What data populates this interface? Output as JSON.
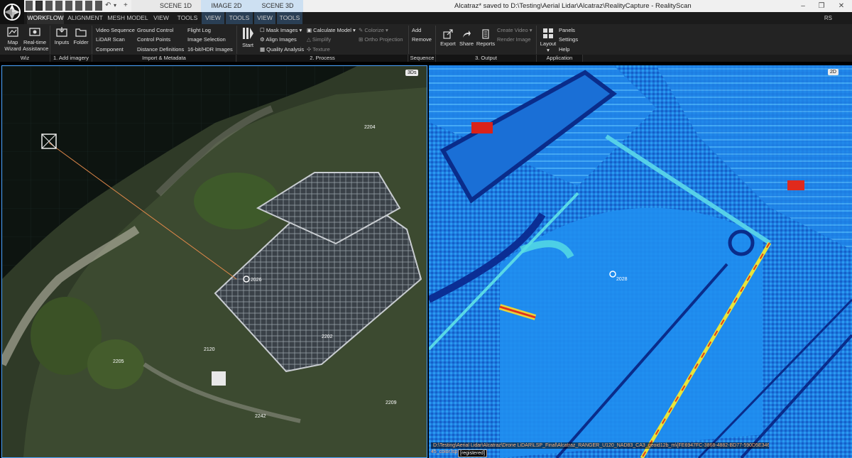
{
  "scene_tabs": [
    {
      "label": "SCENE 1D"
    },
    {
      "label": "IMAGE 2D"
    },
    {
      "label": "SCENE 3D"
    }
  ],
  "window": {
    "title": "Alcatraz* saved to D:\\Testing\\Aerial Lidar\\Alcatraz\\RealityCapture - RealityScan",
    "rs_label": "RS"
  },
  "ribbon_tabs": [
    {
      "label": "WORKFLOW"
    },
    {
      "label": "ALIGNMENT"
    },
    {
      "label": "MESH MODEL"
    },
    {
      "label": "VIEW"
    },
    {
      "label": "TOOLS"
    },
    {
      "label": "VIEW"
    },
    {
      "label": "TOOLS"
    },
    {
      "label": "VIEW"
    },
    {
      "label": "TOOLS"
    }
  ],
  "groups": {
    "wiz": {
      "label": "Wiz",
      "map_wizard": "Map Wizard",
      "realtime": "Real-time Assistance"
    },
    "add_imagery": {
      "label": "1. Add imagery",
      "inputs": "Inputs",
      "folder": "Folder"
    },
    "import_metadata": {
      "label": "Import & Metadata",
      "items": [
        "Video Sequence",
        "LiDAR Scan",
        "Component",
        "Ground Control",
        "Control Points",
        "Distance Definitions",
        "Flight Log",
        "Image Selection",
        "16-bit/HDR Images"
      ]
    },
    "process": {
      "label": "2. Process",
      "start": "Start",
      "mask_images": "Mask Images",
      "align_images": "Align Images",
      "quality_analysis": "Quality Analysis",
      "calculate_model": "Calculate Model",
      "simplify": "Simplify",
      "texture": "Texture",
      "colorize": "Colorize",
      "ortho_projection": "Ortho Projection"
    },
    "sequence": {
      "label": "Sequence",
      "add": "Add",
      "remove": "Remove"
    },
    "output": {
      "label": "3. Output",
      "export": "Export",
      "share": "Share",
      "reports": "Reports",
      "create_video": "Create Video",
      "render_image": "Render Image"
    },
    "application": {
      "label": "Application",
      "layout": "Layout",
      "panels": "Panels",
      "settings": "Settings",
      "help": "Help"
    }
  },
  "viewport_3d": {
    "badge": "3Ds",
    "labels": [
      "2204",
      "2026",
      "2205",
      "2202",
      "2120",
      "2242",
      "2209"
    ]
  },
  "viewport_2d": {
    "badge": "2D",
    "point_label": "2028",
    "status_path": "D:\\Testing\\Aerial Lidar\\Alcatraz\\Drone LiDAR\\LSP_Final\\Alcatraz_RANGER_U120_NAD83_CA3_geoid12b_m\\{FE6947FC-3868-4882-BD77-590D5E346C0}",
    "status_file": "45_color.lsp",
    "status_tag": "[registered]"
  },
  "colors": {
    "accent": "#4aa3ff",
    "ribbon_bg": "#232323",
    "path_text": "#ffb37a"
  }
}
